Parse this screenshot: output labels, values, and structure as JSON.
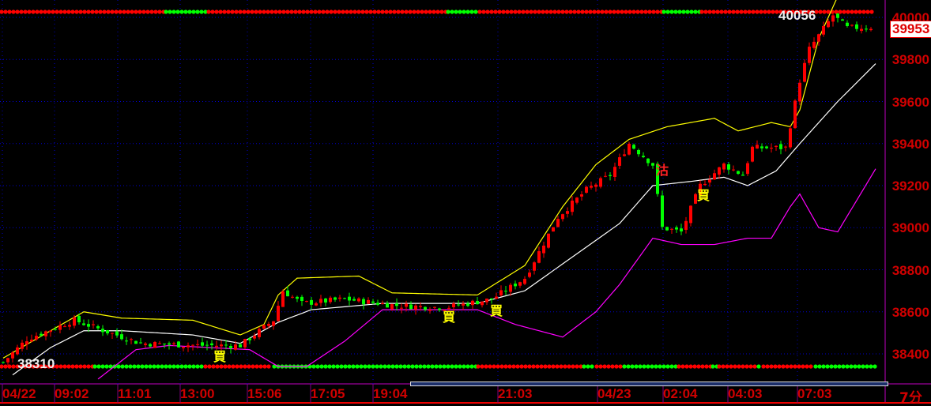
{
  "price_axis": {
    "labels": [
      "40000",
      "39800",
      "39600",
      "39400",
      "39200",
      "39000",
      "38800",
      "38600",
      "38400"
    ]
  },
  "time_axis": {
    "labels": [
      "04/22",
      "09:02",
      "11:01",
      "13:00",
      "15:06",
      "17:05",
      "19:04",
      "21:03",
      "04/23",
      "02:04",
      "04:03",
      "07:03"
    ]
  },
  "last_price": "39953",
  "high_label": "40056",
  "low_label": "38310",
  "period": "7分",
  "signals": [
    {
      "text": "買",
      "color": "#ffff00"
    },
    {
      "text": "買",
      "color": "#ffff00"
    },
    {
      "text": "買",
      "color": "#ffff00"
    },
    {
      "text": "買",
      "color": "#ffff00"
    },
    {
      "text": "沽",
      "color": "#ff2020"
    }
  ],
  "colors": {
    "up": "#ff0000",
    "down": "#00ff00",
    "upper": "#ffff00",
    "mid": "#ffffff",
    "lower": "#ff00ff",
    "grid": "#0000cc"
  },
  "chart_data": {
    "type": "candlestick",
    "bars": 184,
    "ylim": [
      38310,
      40056
    ],
    "close_path": [
      [
        0,
        38360
      ],
      [
        5,
        38470
      ],
      [
        15,
        38560
      ],
      [
        20,
        38520
      ],
      [
        29,
        38450
      ],
      [
        42,
        38440
      ],
      [
        50,
        38440
      ],
      [
        57,
        38560
      ],
      [
        59,
        38700
      ],
      [
        63,
        38640
      ],
      [
        72,
        38660
      ],
      [
        83,
        38630
      ],
      [
        93,
        38620
      ],
      [
        103,
        38660
      ],
      [
        110,
        38760
      ],
      [
        117,
        39050
      ],
      [
        123,
        39180
      ],
      [
        128,
        39250
      ],
      [
        132,
        39400
      ],
      [
        137,
        39300
      ],
      [
        139,
        39000
      ],
      [
        143,
        38980
      ],
      [
        147,
        39200
      ],
      [
        152,
        39300
      ],
      [
        156,
        39250
      ],
      [
        158,
        39380
      ],
      [
        165,
        39380
      ],
      [
        168,
        39700
      ],
      [
        170,
        39850
      ],
      [
        175,
        40010
      ],
      [
        178,
        39950
      ],
      [
        183,
        39953
      ]
    ],
    "upper_band": [
      [
        0,
        38380
      ],
      [
        10,
        38510
      ],
      [
        17,
        38600
      ],
      [
        25,
        38570
      ],
      [
        40,
        38560
      ],
      [
        50,
        38490
      ],
      [
        55,
        38540
      ],
      [
        58,
        38680
      ],
      [
        62,
        38760
      ],
      [
        75,
        38770
      ],
      [
        82,
        38690
      ],
      [
        100,
        38680
      ],
      [
        110,
        38820
      ],
      [
        118,
        39100
      ],
      [
        125,
        39300
      ],
      [
        132,
        39420
      ],
      [
        140,
        39480
      ],
      [
        150,
        39520
      ],
      [
        155,
        39460
      ],
      [
        162,
        39500
      ],
      [
        166,
        39480
      ],
      [
        168,
        39560
      ],
      [
        172,
        39900
      ],
      [
        176,
        40100
      ]
    ],
    "middle_band": [
      [
        2,
        38300
      ],
      [
        10,
        38430
      ],
      [
        17,
        38510
      ],
      [
        25,
        38510
      ],
      [
        40,
        38490
      ],
      [
        50,
        38450
      ],
      [
        58,
        38550
      ],
      [
        65,
        38610
      ],
      [
        80,
        38640
      ],
      [
        100,
        38640
      ],
      [
        110,
        38700
      ],
      [
        120,
        38860
      ],
      [
        130,
        39020
      ],
      [
        137,
        39200
      ],
      [
        145,
        39220
      ],
      [
        152,
        39240
      ],
      [
        157,
        39200
      ],
      [
        163,
        39270
      ],
      [
        168,
        39400
      ],
      [
        176,
        39600
      ],
      [
        184,
        39780
      ]
    ],
    "lower_band": [
      [
        20,
        38280
      ],
      [
        28,
        38420
      ],
      [
        35,
        38440
      ],
      [
        52,
        38420
      ],
      [
        58,
        38340
      ],
      [
        64,
        38340
      ],
      [
        72,
        38460
      ],
      [
        80,
        38610
      ],
      [
        100,
        38610
      ],
      [
        108,
        38540
      ],
      [
        118,
        38480
      ],
      [
        125,
        38600
      ],
      [
        130,
        38730
      ],
      [
        137,
        38950
      ],
      [
        143,
        38920
      ],
      [
        150,
        38920
      ],
      [
        157,
        38950
      ],
      [
        162,
        38950
      ],
      [
        166,
        39100
      ],
      [
        168,
        39160
      ],
      [
        172,
        39000
      ],
      [
        176,
        38980
      ],
      [
        184,
        39280
      ]
    ],
    "top_dots": [
      [
        "r",
        0,
        208
      ],
      [
        "g",
        208,
        262
      ],
      [
        "r",
        262,
        565
      ],
      [
        "g",
        565,
        605
      ],
      [
        "r",
        605,
        838
      ],
      [
        "g",
        838,
        886
      ],
      [
        "r",
        886,
        1108
      ]
    ],
    "bottom_dots": [
      [
        "r",
        0,
        118
      ],
      [
        "g",
        118,
        258
      ],
      [
        "r",
        258,
        345
      ],
      [
        "g",
        345,
        603
      ],
      [
        "r",
        603,
        737
      ],
      [
        "g",
        737,
        753
      ],
      [
        "r",
        753,
        788
      ],
      [
        "g",
        788,
        857
      ],
      [
        "r",
        857,
        900
      ],
      [
        "g",
        900,
        908
      ],
      [
        "r",
        908,
        958
      ],
      [
        "g",
        958,
        964
      ],
      [
        "r",
        964,
        1030
      ],
      [
        "g",
        1030,
        1108
      ]
    ]
  }
}
